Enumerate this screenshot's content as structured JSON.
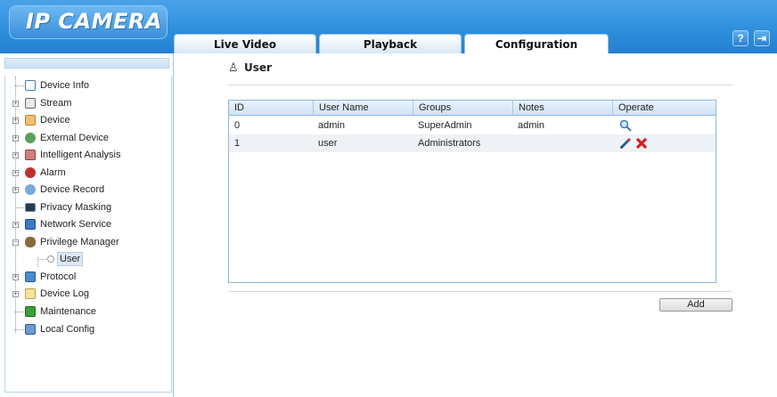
{
  "app": {
    "logo": "IP CAMERA"
  },
  "tabs": [
    {
      "label": "Live Video"
    },
    {
      "label": "Playback"
    },
    {
      "label": "Configuration"
    }
  ],
  "header_buttons": {
    "help": "?",
    "logout": "⇥"
  },
  "sidebar": {
    "items": [
      {
        "label": "Device Info",
        "icon": "device-info-icon",
        "color": "#6fa8dc"
      },
      {
        "label": "Stream",
        "icon": "stream-icon",
        "color": "#888888"
      },
      {
        "label": "Device",
        "icon": "device-icon",
        "color": "#e8a040"
      },
      {
        "label": "External Device",
        "icon": "external-device-icon",
        "color": "#3a8a3a"
      },
      {
        "label": "Intelligent Analysis",
        "icon": "intelligent-analysis-icon",
        "color": "#c05050"
      },
      {
        "label": "Alarm",
        "icon": "alarm-icon",
        "color": "#b03030"
      },
      {
        "label": "Device Record",
        "icon": "device-record-icon",
        "color": "#4a7ab0"
      },
      {
        "label": "Privacy Masking",
        "icon": "privacy-masking-icon",
        "color": "#3a4a5a"
      },
      {
        "label": "Network Service",
        "icon": "network-service-icon",
        "color": "#2a6ab0"
      },
      {
        "label": "Privilege Manager",
        "icon": "privilege-manager-icon",
        "color": "#6a4a2a"
      },
      {
        "label": "User",
        "icon": "user-icon",
        "color": "#999999"
      },
      {
        "label": "Protocol",
        "icon": "protocol-icon",
        "color": "#3a7ac0"
      },
      {
        "label": "Device Log",
        "icon": "device-log-icon",
        "color": "#e0b040"
      },
      {
        "label": "Maintenance",
        "icon": "maintenance-icon",
        "color": "#3a9a3a"
      },
      {
        "label": "Local Config",
        "icon": "local-config-icon",
        "color": "#5a8ac0"
      }
    ]
  },
  "main": {
    "title": "User",
    "columns": [
      "ID",
      "User Name",
      "Groups",
      "Notes",
      "Operate"
    ],
    "rows": [
      {
        "id": "0",
        "user_name": "admin",
        "groups": "SuperAdmin",
        "notes": "admin"
      },
      {
        "id": "1",
        "user_name": "user",
        "groups": "Administrators",
        "notes": ""
      }
    ],
    "add_label": "Add"
  }
}
